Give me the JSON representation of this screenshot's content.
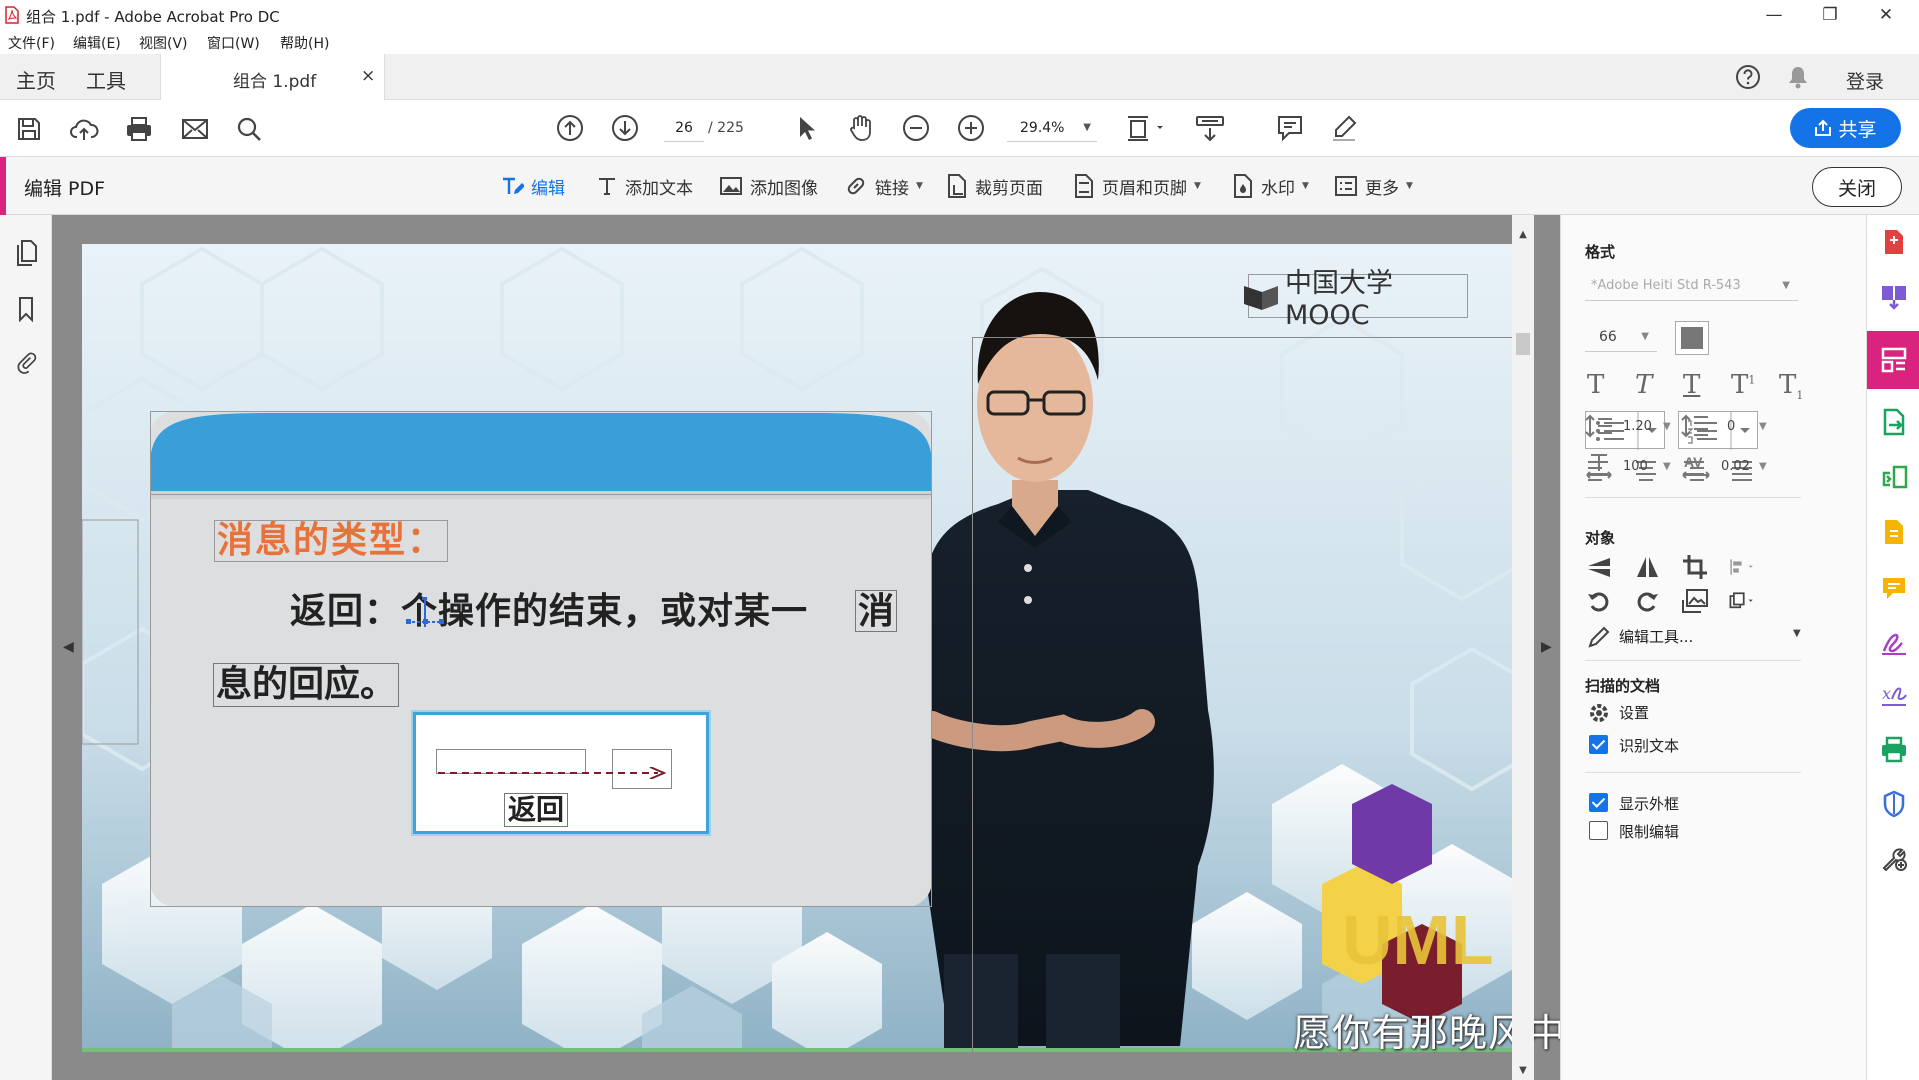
{
  "window": {
    "title": "组合 1.pdf - Adobe Acrobat Pro DC",
    "minimize": "—",
    "restore": "❐",
    "close": "✕"
  },
  "menu": [
    "文件(F)",
    "编辑(E)",
    "视图(V)",
    "窗口(W)",
    "帮助(H)"
  ],
  "tabs": {
    "home": "主页",
    "tools": "工具",
    "document": "组合 1.pdf",
    "document_close": "×"
  },
  "header": {
    "login": "登录"
  },
  "toolbar": {
    "page_current": "26",
    "page_total": "/ 225",
    "zoom": "29.4%",
    "share": "共享"
  },
  "edit_bar": {
    "title": "编辑 PDF",
    "tools": [
      "编辑",
      "添加文本",
      "添加图像",
      "链接",
      "裁剪页面",
      "页眉和页脚",
      "水印",
      "更多"
    ],
    "close": "关闭"
  },
  "page": {
    "logo_text": "中国大学MOOC",
    "heading": "消息的类型：",
    "body_line1": "返回：个操作的结束，或对某一",
    "body_line1_end": "消",
    "body_line2": "息的回应。",
    "diagram_label": "返回",
    "subtitle": "愿你有那晚风中最热烈的欢喜",
    "bottom_logo_letters": "UML"
  },
  "format_panel": {
    "format_title": "格式",
    "font": "*Adobe Heiti Std R-543",
    "font_size": "66",
    "line_spacing": "1.20",
    "paragraph_spacing": "0",
    "horizontal_scale": "100",
    "char_spacing": "0.02",
    "object_title": "对象",
    "edit_tools": "编辑工具...",
    "scan_title": "扫描的文档",
    "settings": "设置",
    "recognize_text": "识别文本",
    "show_bbox": "显示外框",
    "restrict_edit": "限制编辑",
    "recognize_text_checked": true,
    "show_bbox_checked": true,
    "restrict_edit_checked": false
  },
  "colors": {
    "accent": "#d9237f",
    "blue": "#1473e6",
    "heading_orange": "#e8733a",
    "card_band": "#3a9fd8"
  }
}
